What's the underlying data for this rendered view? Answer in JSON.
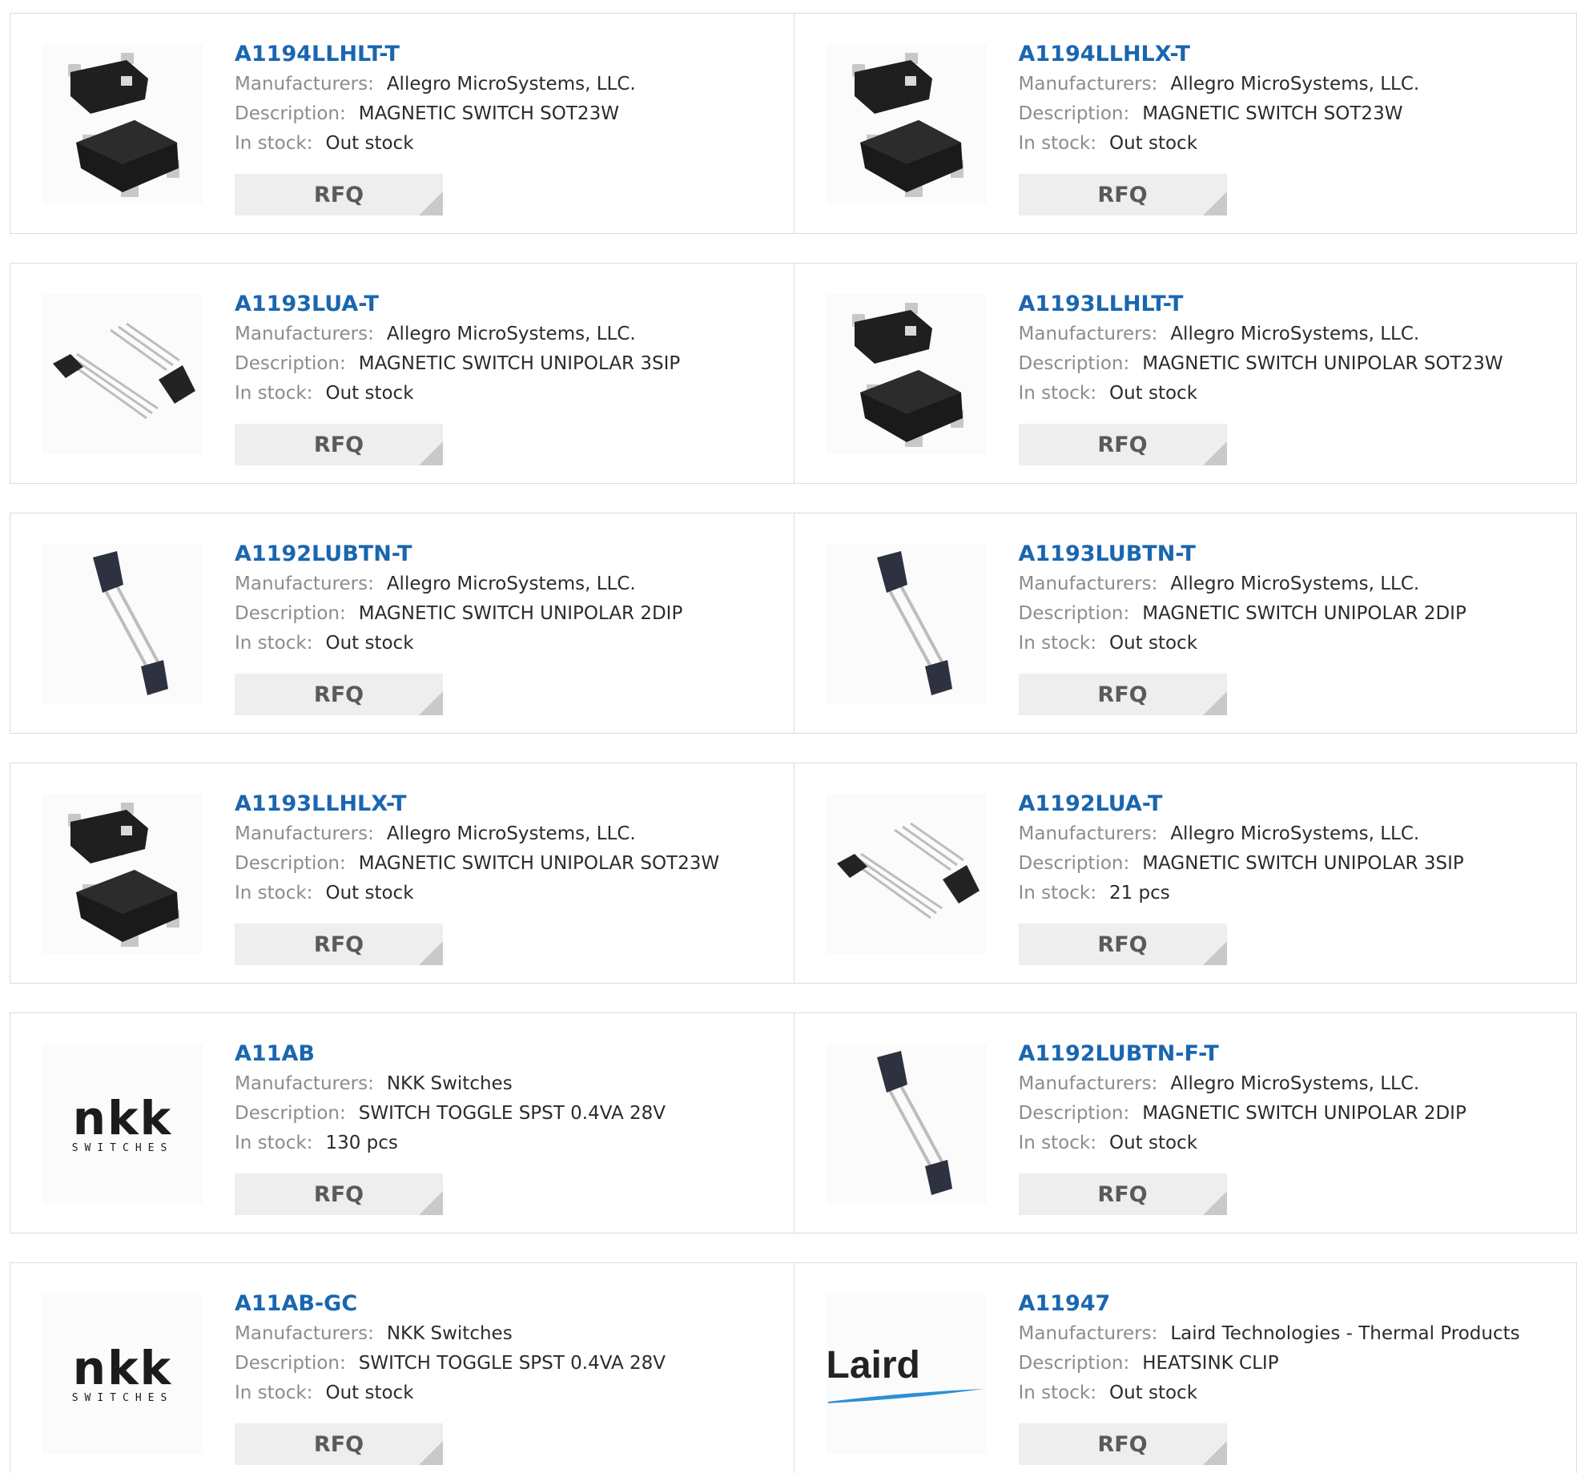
{
  "labels": {
    "manufacturers": "Manufacturers:",
    "description": "Description:",
    "in_stock": "In stock:",
    "rfq": "RFQ"
  },
  "products": [
    {
      "part": "A1194LLHLT-T",
      "manufacturer": "Allegro MicroSystems, LLC.",
      "description": "MAGNETIC SWITCH SOT23W",
      "stock": "Out stock",
      "image": "sot23w-chip-icon"
    },
    {
      "part": "A1194LLHLX-T",
      "manufacturer": "Allegro MicroSystems, LLC.",
      "description": "MAGNETIC SWITCH SOT23W",
      "stock": "Out stock",
      "image": "sot23w-chip-icon"
    },
    {
      "part": "A1193LUA-T",
      "manufacturer": "Allegro MicroSystems, LLC.",
      "description": "MAGNETIC SWITCH UNIPOLAR 3SIP",
      "stock": "Out stock",
      "image": "sip3-chip-icon"
    },
    {
      "part": "A1193LLHLT-T",
      "manufacturer": "Allegro MicroSystems, LLC.",
      "description": "MAGNETIC SWITCH UNIPOLAR SOT23W",
      "stock": "Out stock",
      "image": "sot23w-chip-icon"
    },
    {
      "part": "A1192LUBTN-T",
      "manufacturer": "Allegro MicroSystems, LLC.",
      "description": "MAGNETIC SWITCH UNIPOLAR 2DIP",
      "stock": "Out stock",
      "image": "dip2-chip-icon"
    },
    {
      "part": "A1193LUBTN-T",
      "manufacturer": "Allegro MicroSystems, LLC.",
      "description": "MAGNETIC SWITCH UNIPOLAR 2DIP",
      "stock": "Out stock",
      "image": "dip2-chip-icon"
    },
    {
      "part": "A1193LLHLX-T",
      "manufacturer": "Allegro MicroSystems, LLC.",
      "description": "MAGNETIC SWITCH UNIPOLAR SOT23W",
      "stock": "Out stock",
      "image": "sot23w-chip-icon"
    },
    {
      "part": "A1192LUA-T",
      "manufacturer": "Allegro MicroSystems, LLC.",
      "description": "MAGNETIC SWITCH UNIPOLAR 3SIP",
      "stock": "21 pcs",
      "image": "sip3-chip-icon"
    },
    {
      "part": "A11AB",
      "manufacturer": "NKK Switches",
      "description": "SWITCH TOGGLE SPST 0.4VA 28V",
      "stock": "130 pcs",
      "image": "nkk-switches-logo"
    },
    {
      "part": "A1192LUBTN-F-T",
      "manufacturer": "Allegro MicroSystems, LLC.",
      "description": "MAGNETIC SWITCH UNIPOLAR 2DIP",
      "stock": "Out stock",
      "image": "dip2-chip-icon"
    },
    {
      "part": "A11AB-GC",
      "manufacturer": "NKK Switches",
      "description": "SWITCH TOGGLE SPST 0.4VA 28V",
      "stock": "Out stock",
      "image": "nkk-switches-logo"
    },
    {
      "part": "A11947",
      "manufacturer": "Laird Technologies - Thermal Products",
      "description": "HEATSINK CLIP",
      "stock": "Out stock",
      "image": "laird-logo"
    }
  ],
  "logos": {
    "nkk_letters": "nkk",
    "nkk_sub": "SWITCHES",
    "laird": "Laird"
  },
  "colors": {
    "part_link": "#1a66b0",
    "label": "#8c8c8c",
    "rfq_bg": "#eeeeee",
    "border": "#dcdcdc"
  }
}
